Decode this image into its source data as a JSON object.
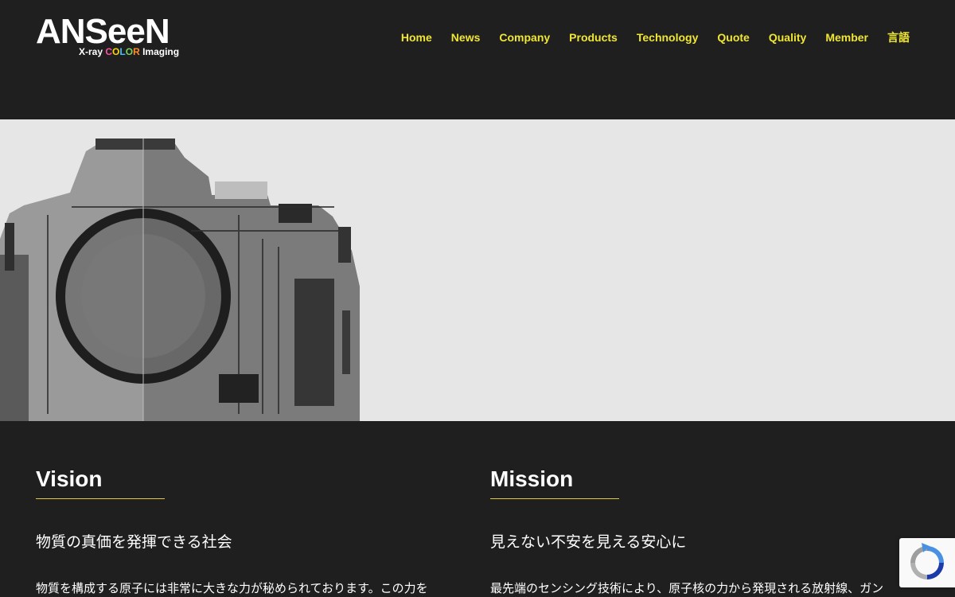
{
  "header": {
    "logo_main": "ANSeeN",
    "logo_sub_prefix": "X-ray ",
    "logo_sub_color": [
      "C",
      "O",
      "L",
      "O",
      "R"
    ],
    "logo_sub_suffix": " Imaging"
  },
  "nav": {
    "items": [
      {
        "label": "Home"
      },
      {
        "label": "News"
      },
      {
        "label": "Company"
      },
      {
        "label": "Products"
      },
      {
        "label": "Technology"
      },
      {
        "label": "Quote"
      },
      {
        "label": "Quality"
      },
      {
        "label": "Member"
      },
      {
        "label": "言語"
      }
    ]
  },
  "hero": {
    "image_icon": "xray-camera-image"
  },
  "vision": {
    "title": "Vision",
    "subtitle": "物質の真価を発揮できる社会",
    "body": "物質を構成する原子には非常に大きな力が秘められております。この力を"
  },
  "mission": {
    "title": "Mission",
    "subtitle": "見えない不安を見える安心に",
    "body": "最先端のセンシング技術により、原子核の力から発現される放射線、ガン"
  },
  "colors": {
    "background": "#1f1f1f",
    "nav_accent": "#f0e635",
    "rule_accent": "#e0c838",
    "hero_bg": "#e6e6e6"
  },
  "recaptcha": {
    "icon": "recaptcha-icon"
  }
}
